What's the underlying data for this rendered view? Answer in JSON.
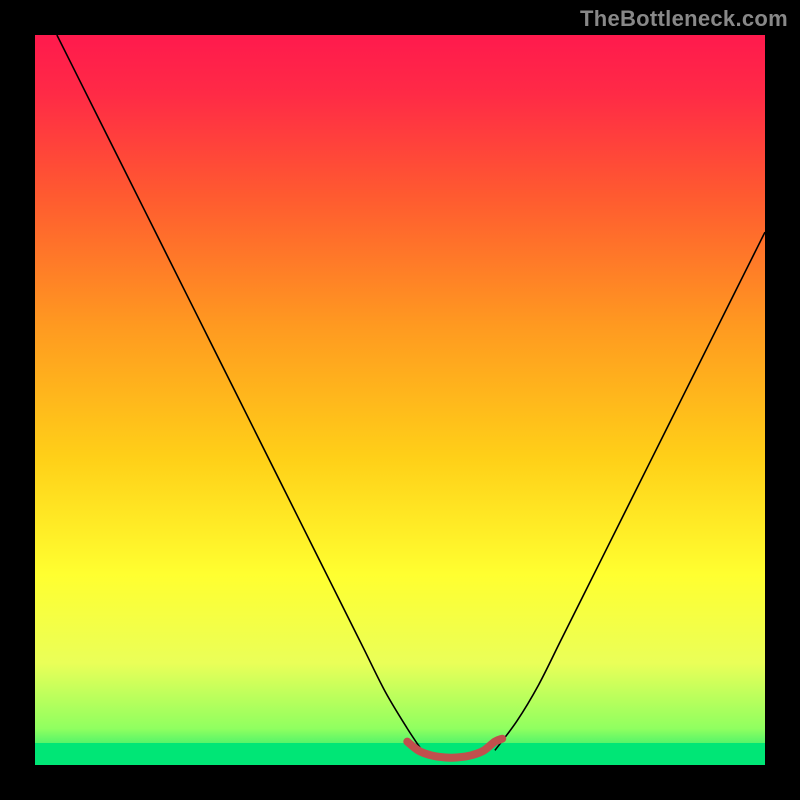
{
  "watermark": "TheBottleneck.com",
  "chart_data": {
    "type": "line",
    "title": "",
    "xlabel": "",
    "ylabel": "",
    "xlim": [
      0,
      100
    ],
    "ylim": [
      0,
      100
    ],
    "grid": false,
    "legend": false,
    "background_gradient_vertical": {
      "colors": [
        "#ff0040",
        "#ff3a3a",
        "#ff8a28",
        "#ffd020",
        "#ffff30",
        "#e8ff5c",
        "#5cff60",
        "#00e676"
      ],
      "direction": "top-to-bottom"
    },
    "bottom_green_band": {
      "y_from": 0,
      "y_to": 3,
      "color": "#00e676"
    },
    "series": [
      {
        "name": "left-descent",
        "style": "thin-black",
        "x": [
          3,
          6,
          9,
          12,
          15,
          18,
          21,
          24,
          27,
          30,
          33,
          36,
          39,
          42,
          45,
          48,
          51,
          53
        ],
        "y": [
          100,
          94,
          88,
          82,
          76,
          70,
          64,
          58,
          52,
          46,
          40,
          34,
          28,
          22,
          16,
          10,
          5,
          2
        ]
      },
      {
        "name": "right-ascent",
        "style": "thin-black",
        "x": [
          63,
          66,
          69,
          72,
          75,
          78,
          81,
          84,
          87,
          90,
          93,
          96,
          99,
          100
        ],
        "y": [
          2,
          6,
          11,
          17,
          23,
          29,
          35,
          41,
          47,
          53,
          59,
          65,
          71,
          73
        ]
      },
      {
        "name": "valley-floor",
        "style": "thick-orange-red",
        "x": [
          51,
          52.5,
          54,
          55.5,
          57,
          58.5,
          60,
          61.5,
          63,
          64
        ],
        "y": [
          3.2,
          2.0,
          1.4,
          1.1,
          1.0,
          1.1,
          1.4,
          2.0,
          3.2,
          3.6
        ]
      }
    ]
  }
}
